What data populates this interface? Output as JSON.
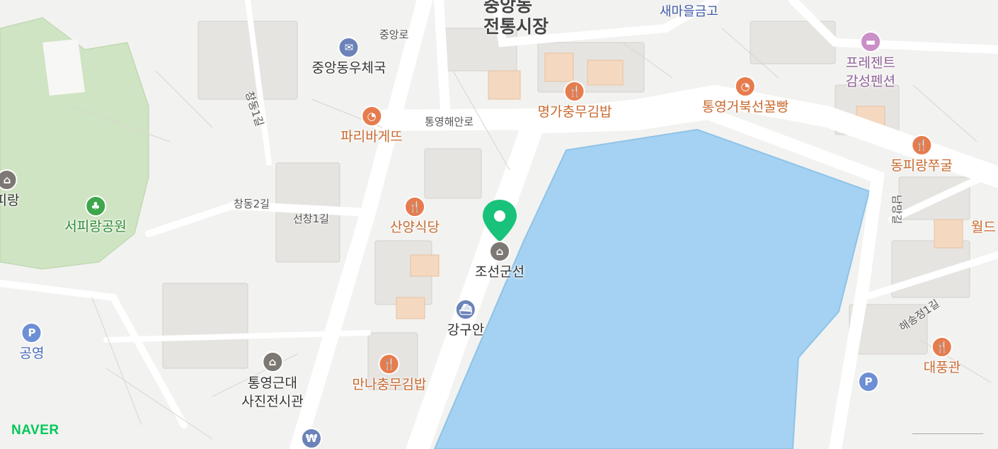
{
  "map": {
    "brand": "NAVER",
    "selected_place": "조선군선",
    "district_lines": [
      "중앙동",
      "전통시장"
    ],
    "roads": [
      "중앙로",
      "통영해안로",
      "창동1길",
      "창동2길",
      "선창1길",
      "남망길",
      "해송정1길"
    ],
    "pois": {
      "post_office": "중앙동우체국",
      "paris": "파리바게뜨",
      "myeongga": "명가충무김밥",
      "turtle_bread": "통영거북선꿀빵",
      "present": "프레젠트\n감성펜션",
      "dongpirang": "동피랑쭈굴",
      "sanyang": "산양식당",
      "gangguan": "강구안",
      "manna": "만나충무김밥",
      "photo_museum": "통영근대\n사진전시관",
      "park": "서피랑공원",
      "pirang": "피랑",
      "parking_left": "공영",
      "daepung": "대풍관",
      "world": "월드",
      "saemaul": "새마을금고"
    },
    "colors": {
      "water": "#a5d2f2",
      "park": "#bfdcae",
      "restaurant": "#e67c4e",
      "marker": "#19c27a"
    }
  }
}
